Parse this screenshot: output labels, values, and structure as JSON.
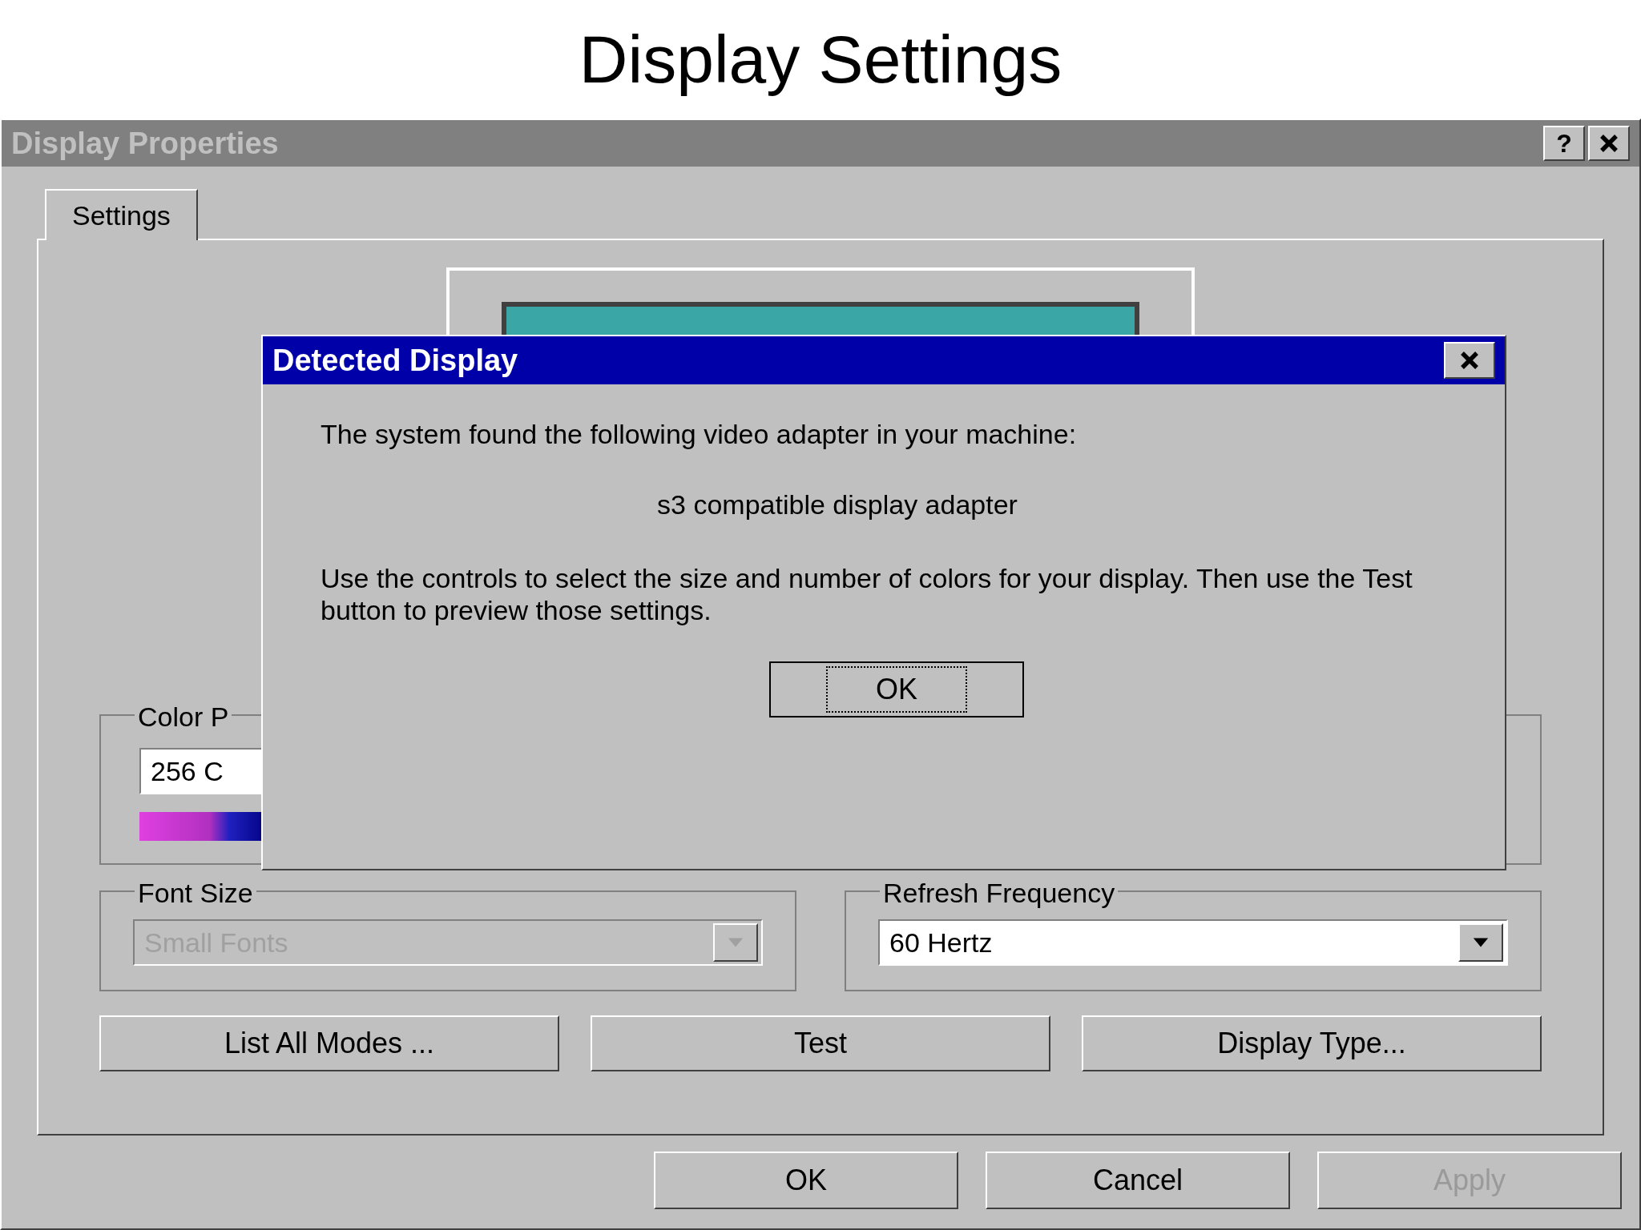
{
  "slide_title": "Display Settings",
  "window": {
    "title": "Display Properties",
    "active": false,
    "help": "?"
  },
  "tabs": [
    {
      "label": "Settings",
      "selected": true
    }
  ],
  "color_palette": {
    "label": "Color P",
    "value": "256 C"
  },
  "font_size": {
    "label": "Font Size",
    "value": "Small Fonts",
    "disabled": true
  },
  "refresh_frequency": {
    "label": "Refresh Frequency",
    "value": "60 Hertz",
    "disabled": false
  },
  "panel_buttons": [
    {
      "label": "List All Modes ..."
    },
    {
      "label": "Test"
    },
    {
      "label": "Display Type..."
    }
  ],
  "buttons": [
    {
      "label": "OK",
      "disabled": false
    },
    {
      "label": "Cancel",
      "disabled": false
    },
    {
      "label": "Apply",
      "disabled": true
    }
  ],
  "dialog": {
    "title": "Detected Display",
    "message": "The system found the following video adapter in your machine:",
    "adapter": "s3 compatible display adapter",
    "instructions": "Use the controls to select the size and number of colors for your display.  Then use the Test button to preview those settings.",
    "button": {
      "label": "OK",
      "focused": true
    }
  }
}
